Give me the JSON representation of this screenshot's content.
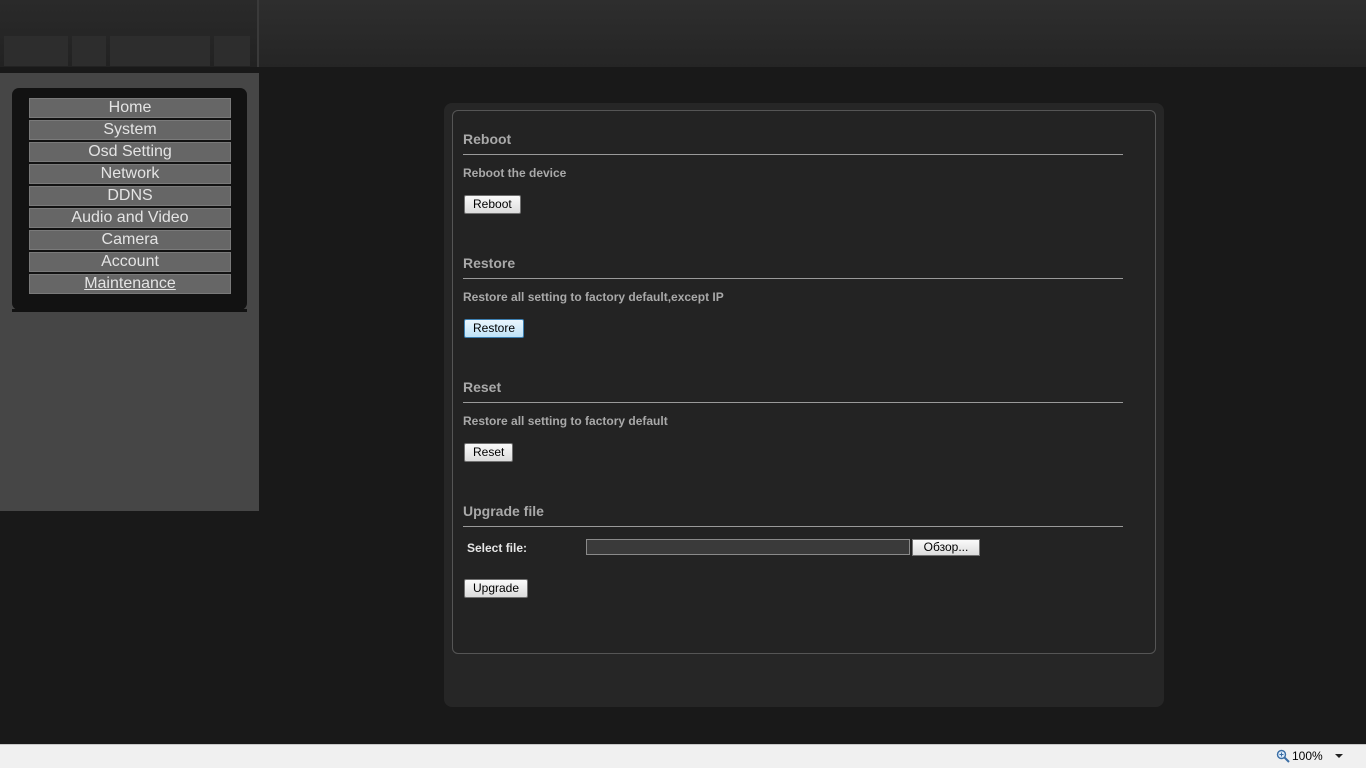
{
  "sidebar": {
    "items": [
      {
        "label": "Home"
      },
      {
        "label": "System"
      },
      {
        "label": "Osd Setting"
      },
      {
        "label": "Network"
      },
      {
        "label": "DDNS"
      },
      {
        "label": "Audio and Video"
      },
      {
        "label": "Camera"
      },
      {
        "label": "Account"
      },
      {
        "label": "Maintenance",
        "active": true
      }
    ]
  },
  "main": {
    "reboot": {
      "title": "Reboot",
      "description": "Reboot the device",
      "button": "Reboot"
    },
    "restore": {
      "title": "Restore",
      "description": "Restore all setting to factory default,except IP",
      "button": "Restore"
    },
    "reset": {
      "title": "Reset",
      "description": "Restore all setting to factory default",
      "button": "Reset"
    },
    "upgrade": {
      "title": "Upgrade file",
      "select_label": "Select file:",
      "file_value": "",
      "browse_button": "Обзор...",
      "button": "Upgrade"
    }
  },
  "statusbar": {
    "zoom": "100%",
    "zoom_icon": "magnifier-icon",
    "dropdown_icon": "chevron-down-icon"
  },
  "colors": {
    "background": "#191919",
    "sidebar": "#464646",
    "menu_item": "#666666",
    "panel": "#262626",
    "text": "#a9a9a9"
  }
}
